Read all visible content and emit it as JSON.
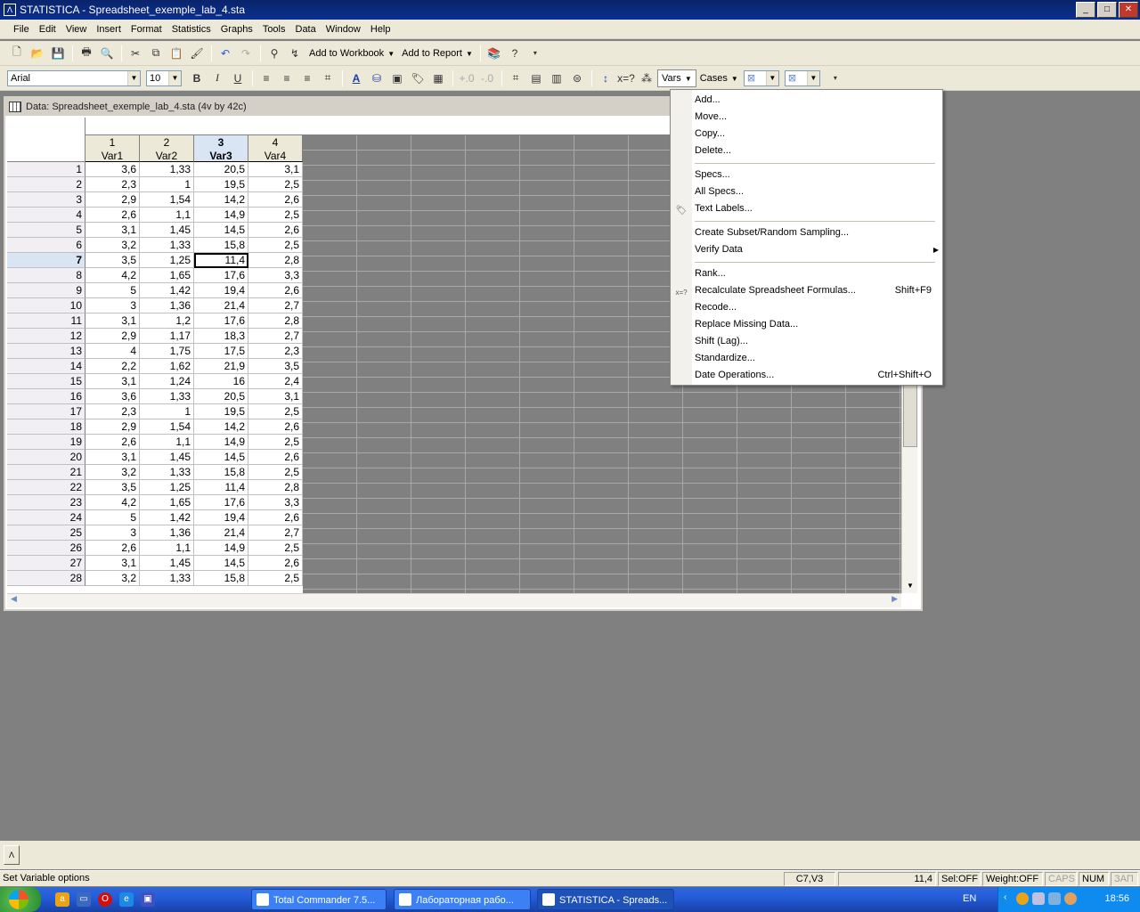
{
  "window": {
    "title": "STATISTICA - Spreadsheet_exemple_lab_4.sta",
    "minimize": "_",
    "maximize": "□",
    "close": "✕"
  },
  "menu": [
    "File",
    "Edit",
    "View",
    "Insert",
    "Format",
    "Statistics",
    "Graphs",
    "Tools",
    "Data",
    "Window",
    "Help"
  ],
  "toolbar1": {
    "add_to_workbook": "Add to Workbook",
    "add_to_report": "Add to Report"
  },
  "toolbar2": {
    "font": "Arial",
    "size": "10",
    "bold": "B",
    "italic": "I",
    "underline": "U",
    "vars": "Vars",
    "cases": "Cases"
  },
  "sheet": {
    "title": "Data: Spreadsheet_exemple_lab_4.sta (4v by 42c)",
    "columns": [
      {
        "num": "1",
        "name": "Var1"
      },
      {
        "num": "2",
        "name": "Var2"
      },
      {
        "num": "3",
        "name": "Var3"
      },
      {
        "num": "4",
        "name": "Var4"
      }
    ],
    "rows": [
      [
        "1",
        "3,6",
        "1,33",
        "20,5",
        "3,1"
      ],
      [
        "2",
        "2,3",
        "1",
        "19,5",
        "2,5"
      ],
      [
        "3",
        "2,9",
        "1,54",
        "14,2",
        "2,6"
      ],
      [
        "4",
        "2,6",
        "1,1",
        "14,9",
        "2,5"
      ],
      [
        "5",
        "3,1",
        "1,45",
        "14,5",
        "2,6"
      ],
      [
        "6",
        "3,2",
        "1,33",
        "15,8",
        "2,5"
      ],
      [
        "7",
        "3,5",
        "1,25",
        "11,4",
        "2,8"
      ],
      [
        "8",
        "4,2",
        "1,65",
        "17,6",
        "3,3"
      ],
      [
        "9",
        "5",
        "1,42",
        "19,4",
        "2,6"
      ],
      [
        "10",
        "3",
        "1,36",
        "21,4",
        "2,7"
      ],
      [
        "11",
        "3,1",
        "1,2",
        "17,6",
        "2,8"
      ],
      [
        "12",
        "2,9",
        "1,17",
        "18,3",
        "2,7"
      ],
      [
        "13",
        "4",
        "1,75",
        "17,5",
        "2,3"
      ],
      [
        "14",
        "2,2",
        "1,62",
        "21,9",
        "3,5"
      ],
      [
        "15",
        "3,1",
        "1,24",
        "16",
        "2,4"
      ],
      [
        "16",
        "3,6",
        "1,33",
        "20,5",
        "3,1"
      ],
      [
        "17",
        "2,3",
        "1",
        "19,5",
        "2,5"
      ],
      [
        "18",
        "2,9",
        "1,54",
        "14,2",
        "2,6"
      ],
      [
        "19",
        "2,6",
        "1,1",
        "14,9",
        "2,5"
      ],
      [
        "20",
        "3,1",
        "1,45",
        "14,5",
        "2,6"
      ],
      [
        "21",
        "3,2",
        "1,33",
        "15,8",
        "2,5"
      ],
      [
        "22",
        "3,5",
        "1,25",
        "11,4",
        "2,8"
      ],
      [
        "23",
        "4,2",
        "1,65",
        "17,6",
        "3,3"
      ],
      [
        "24",
        "5",
        "1,42",
        "19,4",
        "2,6"
      ],
      [
        "25",
        "3",
        "1,36",
        "21,4",
        "2,7"
      ],
      [
        "26",
        "2,6",
        "1,1",
        "14,9",
        "2,5"
      ],
      [
        "27",
        "3,1",
        "1,45",
        "14,5",
        "2,6"
      ],
      [
        "28",
        "3,2",
        "1,33",
        "15,8",
        "2,5"
      ]
    ],
    "active_row": "7",
    "active_col": "3"
  },
  "vars_menu": {
    "items": [
      {
        "label": "Add...",
        "shortcut": ""
      },
      {
        "label": "Move...",
        "shortcut": ""
      },
      {
        "label": "Copy...",
        "shortcut": ""
      },
      {
        "label": "Delete...",
        "shortcut": ""
      },
      {
        "label": "Specs...",
        "shortcut": ""
      },
      {
        "label": "All Specs...",
        "shortcut": ""
      },
      {
        "label": "Text Labels...",
        "shortcut": ""
      },
      {
        "label": "Create Subset/Random Sampling...",
        "shortcut": ""
      },
      {
        "label": "Verify Data",
        "shortcut": ""
      },
      {
        "label": "Rank...",
        "shortcut": ""
      },
      {
        "label": "Recalculate Spreadsheet Formulas...",
        "shortcut": "Shift+F9"
      },
      {
        "label": "Recode...",
        "shortcut": ""
      },
      {
        "label": "Replace Missing Data...",
        "shortcut": ""
      },
      {
        "label": "Shift (Lag)...",
        "shortcut": ""
      },
      {
        "label": "Standardize...",
        "shortcut": ""
      },
      {
        "label": "Date Operations...",
        "shortcut": "Ctrl+Shift+O"
      }
    ]
  },
  "statusbar": {
    "message": "Set Variable options",
    "cell_ref": "C7,V3",
    "cell_value": "11,4",
    "sel": "Sel:OFF",
    "weight": "Weight:OFF",
    "caps": "CAPS",
    "num": "NUM",
    "rec": "ЗАП"
  },
  "taskbar": {
    "tasks": [
      "Total Commander 7.5...",
      "Лабораторная рабо...",
      "STATISTICA - Spreads..."
    ],
    "lang": "EN",
    "time": "18:56"
  }
}
